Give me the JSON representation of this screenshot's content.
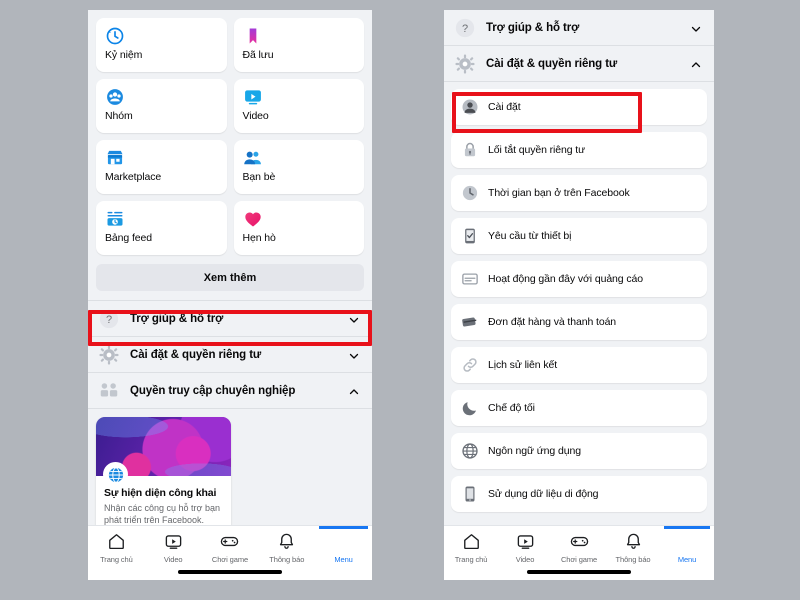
{
  "colors": {
    "page_background": "#b1b5bb",
    "panel_background": "#f0f2f5",
    "card": "#ffffff",
    "accent_blue": "#1877f2",
    "annotation_red": "#e8111a",
    "text_primary": "#080809",
    "text_secondary": "#65676b"
  },
  "left_panel": {
    "shortcuts": [
      {
        "label": "Kỷ niệm",
        "icon": "clock-icon"
      },
      {
        "label": "Đã lưu",
        "icon": "bookmark-icon"
      },
      {
        "label": "Nhóm",
        "icon": "groups-icon"
      },
      {
        "label": "Video",
        "icon": "video-icon"
      },
      {
        "label": "Marketplace",
        "icon": "storefront-icon"
      },
      {
        "label": "Bạn bè",
        "icon": "friends-icon"
      },
      {
        "label": "Bảng feed",
        "icon": "feeds-icon"
      },
      {
        "label": "Hẹn hò",
        "icon": "heart-icon"
      }
    ],
    "see_more_label": "Xem thêm",
    "accordions": [
      {
        "label": "Trợ giúp & hỗ trợ",
        "icon": "help-circle-icon",
        "state": "collapsed",
        "chevron": "chevron-down-icon"
      },
      {
        "label": "Cài đặt & quyền riêng tư",
        "icon": "gear-icon",
        "state": "collapsed",
        "chevron": "chevron-down-icon"
      },
      {
        "label": "Quyền truy cập chuyên nghiệp",
        "icon": "professional-icon",
        "state": "expanded",
        "chevron": "chevron-up-icon"
      }
    ],
    "promo_card": {
      "title": "Sự hiện diện công khai",
      "description": "Nhận các công cụ hỗ trợ bạn phát triển trên Facebook.",
      "badge_icon": "globe-badge-icon"
    }
  },
  "right_panel": {
    "accordions": [
      {
        "label": "Trợ giúp & hỗ trợ",
        "icon": "help-circle-icon",
        "state": "collapsed",
        "chevron": "chevron-down-icon"
      },
      {
        "label": "Cài đặt & quyền riêng tư",
        "icon": "gear-icon",
        "state": "expanded",
        "chevron": "chevron-up-icon"
      }
    ],
    "settings_items": [
      {
        "label": "Cài đặt",
        "icon": "account-avatar-icon",
        "highlighted": true
      },
      {
        "label": "Lối tắt quyền riêng tư",
        "icon": "lock-icon",
        "highlighted": false
      },
      {
        "label": "Thời gian bạn ở trên Facebook",
        "icon": "clock-icon",
        "highlighted": false
      },
      {
        "label": "Yêu cầu từ thiết bị",
        "icon": "device-check-icon",
        "highlighted": false
      },
      {
        "label": "Hoạt động gần đây với quảng cáo",
        "icon": "ad-activity-icon",
        "highlighted": false
      },
      {
        "label": "Đơn đặt hàng và thanh toán",
        "icon": "payment-card-icon",
        "highlighted": false
      },
      {
        "label": "Lịch sử liên kết",
        "icon": "link-icon",
        "highlighted": false
      },
      {
        "label": "Chế độ tối",
        "icon": "moon-icon",
        "highlighted": false
      },
      {
        "label": "Ngôn ngữ ứng dụng",
        "icon": "globe-icon",
        "highlighted": false
      },
      {
        "label": "Sử dụng dữ liệu di động",
        "icon": "mobile-phone-icon",
        "highlighted": false
      }
    ]
  },
  "tabbar": {
    "tabs": [
      {
        "label": "Trang chủ",
        "icon": "home-icon",
        "active": false
      },
      {
        "label": "Video",
        "icon": "video-play-icon",
        "active": false
      },
      {
        "label": "Chơi game",
        "icon": "gamepad-icon",
        "active": false
      },
      {
        "label": "Thông báo",
        "icon": "bell-icon",
        "active": false
      },
      {
        "label": "Menu",
        "icon": "hamburger-icon",
        "active": true
      }
    ]
  }
}
